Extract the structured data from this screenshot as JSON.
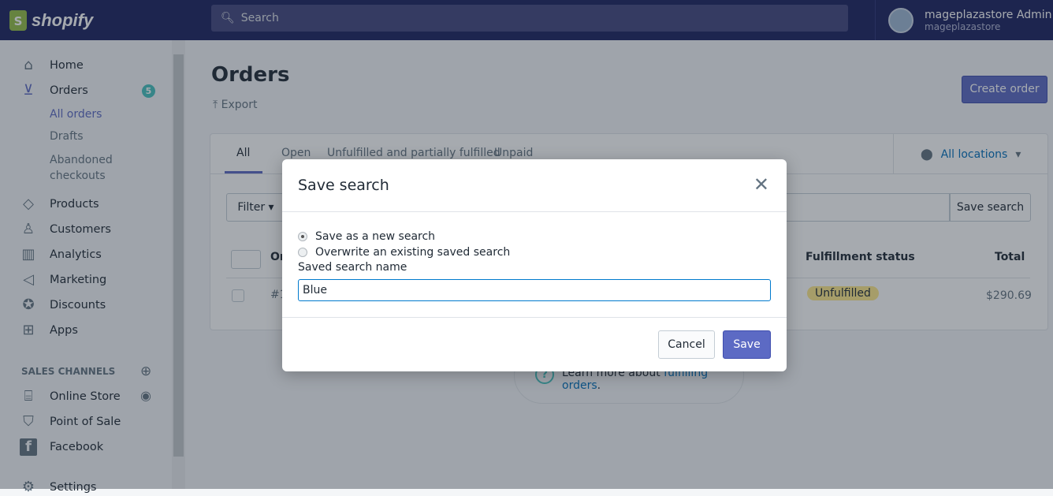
{
  "topbar": {
    "logo_text": "shopify",
    "search_placeholder": "Search",
    "user_name": "mageplazastore Admin",
    "store_name": "mageplazastore"
  },
  "sidebar": {
    "items": [
      {
        "label": "Home",
        "icon": "home-icon"
      },
      {
        "label": "Orders",
        "icon": "orders-icon",
        "badge": "5"
      },
      {
        "label": "Products",
        "icon": "tag-icon"
      },
      {
        "label": "Customers",
        "icon": "person-icon"
      },
      {
        "label": "Analytics",
        "icon": "bar-chart-icon"
      },
      {
        "label": "Marketing",
        "icon": "megaphone-icon"
      },
      {
        "label": "Discounts",
        "icon": "discount-icon"
      },
      {
        "label": "Apps",
        "icon": "apps-icon"
      }
    ],
    "orders_sub": [
      "All orders",
      "Drafts",
      "Abandoned checkouts"
    ],
    "sales_channels_title": "SALES CHANNELS",
    "channels": [
      {
        "label": "Online Store"
      },
      {
        "label": "Point of Sale"
      },
      {
        "label": "Facebook"
      }
    ],
    "settings": "Settings"
  },
  "page": {
    "title": "Orders",
    "export": "Export",
    "create_order": "Create order",
    "tabs": [
      "All",
      "Open",
      "Unfulfilled and partially fulfilled",
      "Unpaid"
    ],
    "locations": "All locations",
    "filter": "Filter",
    "save_search": "Save search",
    "columns": {
      "order": "Or",
      "fulfillment": "Fulfillment status",
      "total": "Total"
    },
    "row": {
      "order": "#1",
      "fulfillment": "Unfulfilled",
      "total": "$290.69"
    },
    "learn_prefix": "Learn more about ",
    "learn_link": "fulfilling orders",
    "learn_suffix": "."
  },
  "modal": {
    "title": "Save search",
    "option_new": "Save as a new search",
    "option_overwrite": "Overwrite an existing saved search",
    "selected": "new",
    "field_label": "Saved search name",
    "field_value": "Blue",
    "cancel": "Cancel",
    "save": "Save"
  },
  "colors": {
    "accent": "#5c6ac4",
    "topbar": "#1c2260",
    "badge": "#47c1bf",
    "unfulfilled": "#ffea8a",
    "link": "#006fbb"
  }
}
